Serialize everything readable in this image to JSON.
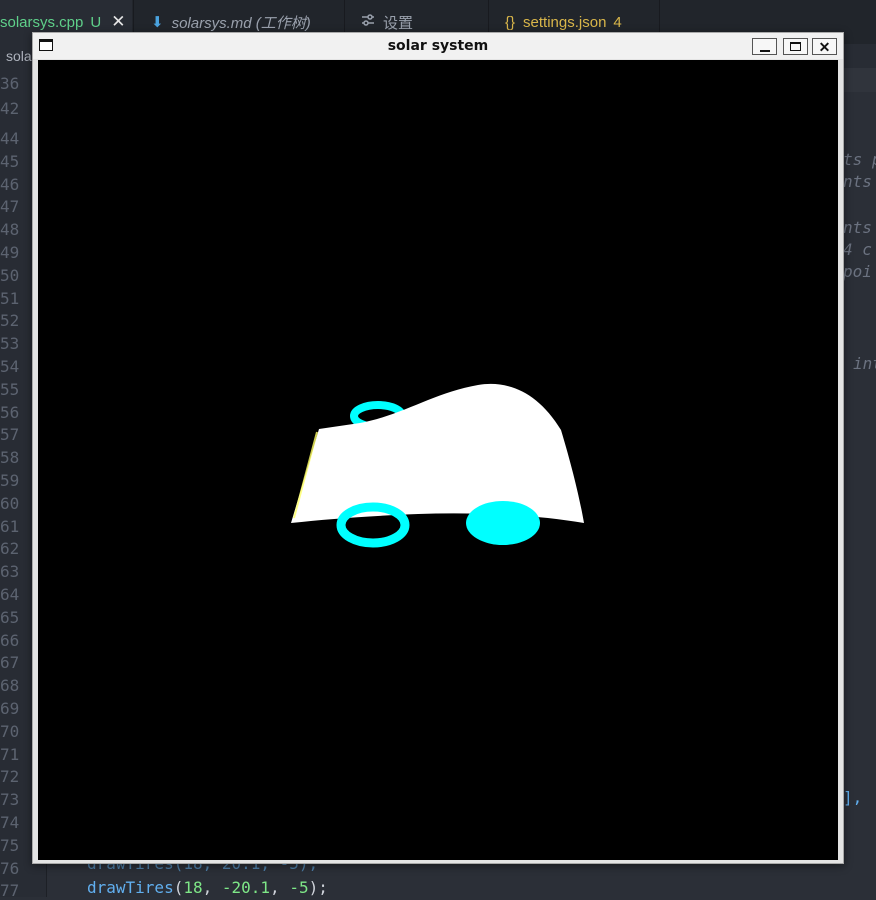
{
  "editor": {
    "tabs": [
      {
        "label": "solarsys.cpp",
        "badge": "U",
        "close": "✕"
      },
      {
        "label": "solarsys.md (工作树)",
        "icon": "⬇"
      },
      {
        "label": "设置",
        "icon": "⚙"
      },
      {
        "label": "settings.json",
        "badge": "4",
        "icon": "{}"
      }
    ],
    "breadcrumb": "sola",
    "line_numbers": [
      "36",
      "42",
      "44",
      "45",
      "46",
      "47",
      "48",
      "49",
      "50",
      "51",
      "52",
      "53",
      "54",
      "55",
      "56",
      "57",
      "58",
      "59",
      "60",
      "61",
      "62",
      "63",
      "64",
      "65",
      "66",
      "67",
      "68",
      "69",
      "70",
      "71",
      "72",
      "73",
      "74",
      "75",
      "76",
      "77"
    ],
    "fragments": [
      "ts p",
      "nts",
      "nts",
      "4 c",
      "poi",
      "int",
      "],",
      "drawTires(18, 20.1, -5);"
    ],
    "code_last_line": {
      "fn": "drawTires",
      "open": "(",
      "a": "18",
      "sep1": ", ",
      "b": "-20.1",
      "sep2": ", ",
      "c": "-5",
      "close": ");"
    }
  },
  "window": {
    "title": "solar system",
    "buttons": {
      "minimize": "_",
      "maximize": "□",
      "close": "✕"
    },
    "scene": {
      "background": "#000000",
      "body_color": "#ffffff",
      "tire_color": "#00ffff",
      "accent": "#ffff00"
    }
  }
}
